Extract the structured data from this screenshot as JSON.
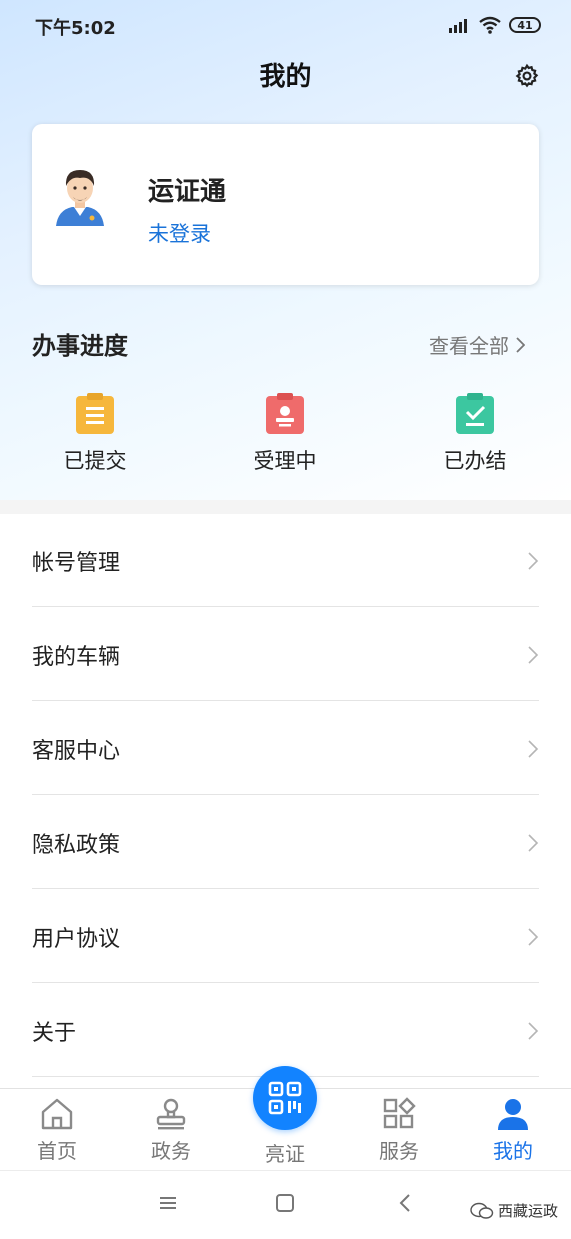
{
  "status_bar": {
    "time": "下午5:02",
    "battery": "41"
  },
  "header": {
    "title": "我的"
  },
  "profile": {
    "name": "运证通",
    "login_text": "未登录"
  },
  "progress": {
    "title": "办事进度",
    "view_all": "查看全部",
    "items": [
      {
        "label": "已提交",
        "icon": "clipboard-submitted-icon",
        "color": "#f6b73c"
      },
      {
        "label": "受理中",
        "icon": "clipboard-processing-icon",
        "color": "#ef6b6b"
      },
      {
        "label": "已办结",
        "icon": "clipboard-done-icon",
        "color": "#3cc7a0"
      }
    ]
  },
  "menu": {
    "items": [
      {
        "label": "帐号管理"
      },
      {
        "label": "我的车辆"
      },
      {
        "label": "客服中心"
      },
      {
        "label": "隐私政策"
      },
      {
        "label": "用户协议"
      },
      {
        "label": "关于"
      }
    ]
  },
  "tabbar": {
    "tabs": [
      {
        "label": "首页",
        "icon": "home-icon"
      },
      {
        "label": "政务",
        "icon": "stamp-icon"
      },
      {
        "label": "亮证",
        "icon": "qr-code-icon"
      },
      {
        "label": "服务",
        "icon": "apps-grid-icon"
      },
      {
        "label": "我的",
        "icon": "person-icon",
        "active": true
      }
    ]
  },
  "watermark": {
    "text": "西藏运政"
  },
  "colors": {
    "accent": "#1a73e8",
    "fab": "#1283ff",
    "link": "#1a73d9"
  }
}
